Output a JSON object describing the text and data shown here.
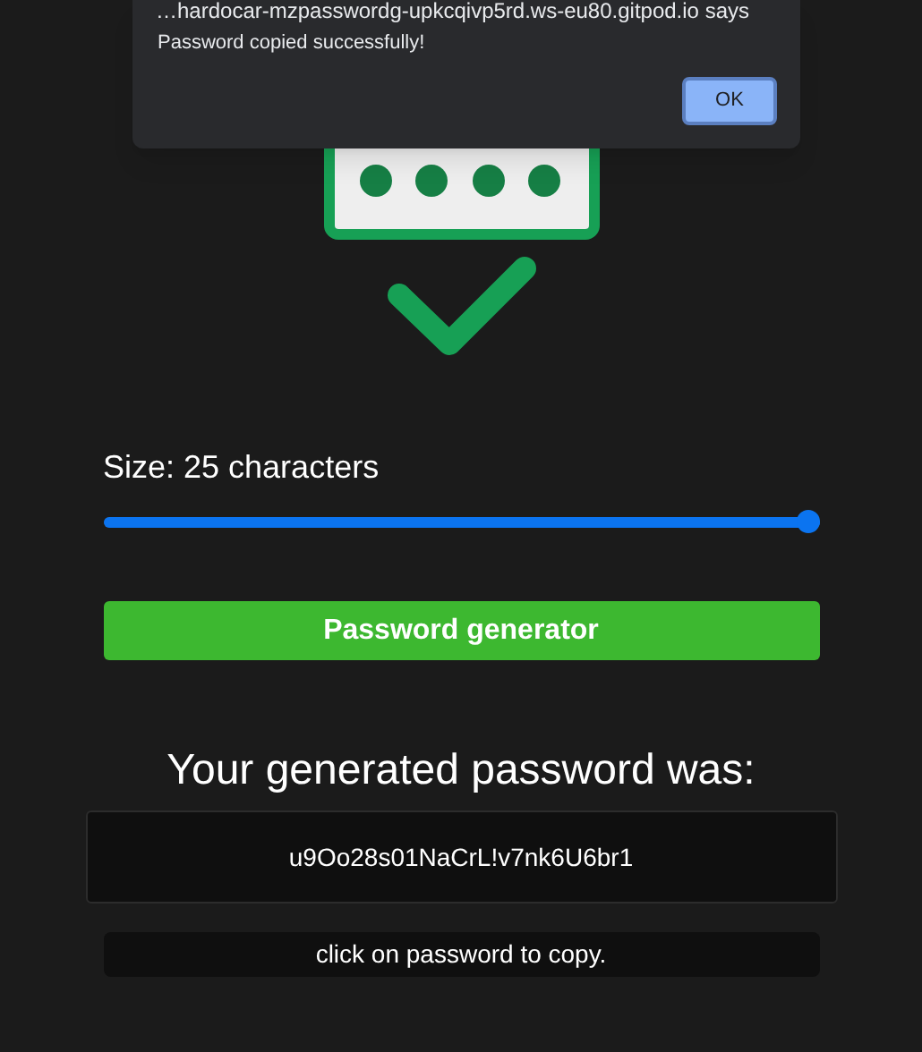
{
  "dialog": {
    "title": "…hardocar-mzpasswordg-upkcqivp5rd.ws-eu80.gitpod.io says",
    "message": "Password copied successfully!",
    "button": "OK"
  },
  "size_label": "Size: 25 characters",
  "slider": {
    "level": 1
  },
  "generate_button": "Password generator",
  "result_heading": "Your generated password was:",
  "password": "u9Oo28s01NaCrL!v7nk6U6br1",
  "hint": "click on password to copy."
}
